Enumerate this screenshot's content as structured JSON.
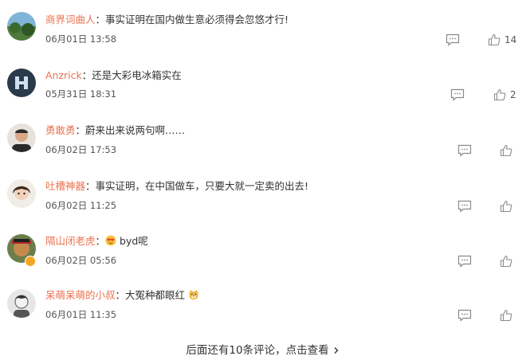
{
  "comments": [
    {
      "user": "商界词曲人",
      "text": "事实证明在国内做生意必须得会忽悠才行!",
      "time": "06月01日 13:58",
      "likes": "14"
    },
    {
      "user": "Anzrick",
      "text": "还是大彩电冰箱实在",
      "time": "05月31日 18:31",
      "likes": "2"
    },
    {
      "user": "勇敢勇",
      "text": "蔚来出来说两句啊……",
      "time": "06月02日 17:53",
      "likes": ""
    },
    {
      "user": "吐槽神器",
      "text": "事实证明，在中国做车，只要大就一定卖的出去!",
      "time": "06月02日 11:25",
      "likes": ""
    },
    {
      "user": "隔山闭老虎",
      "text": "byd呢",
      "time": "06月02日 05:56",
      "likes": ""
    },
    {
      "user": "呆萌呆萌的小叔",
      "text": "大冤种都眼红",
      "time": "06月01日 11:35",
      "likes": ""
    }
  ],
  "colon": "：",
  "load_more": "后面还有10条评论，点击查看",
  "colors": {
    "username": "#eb7350",
    "icon": "#8a8a8a"
  }
}
